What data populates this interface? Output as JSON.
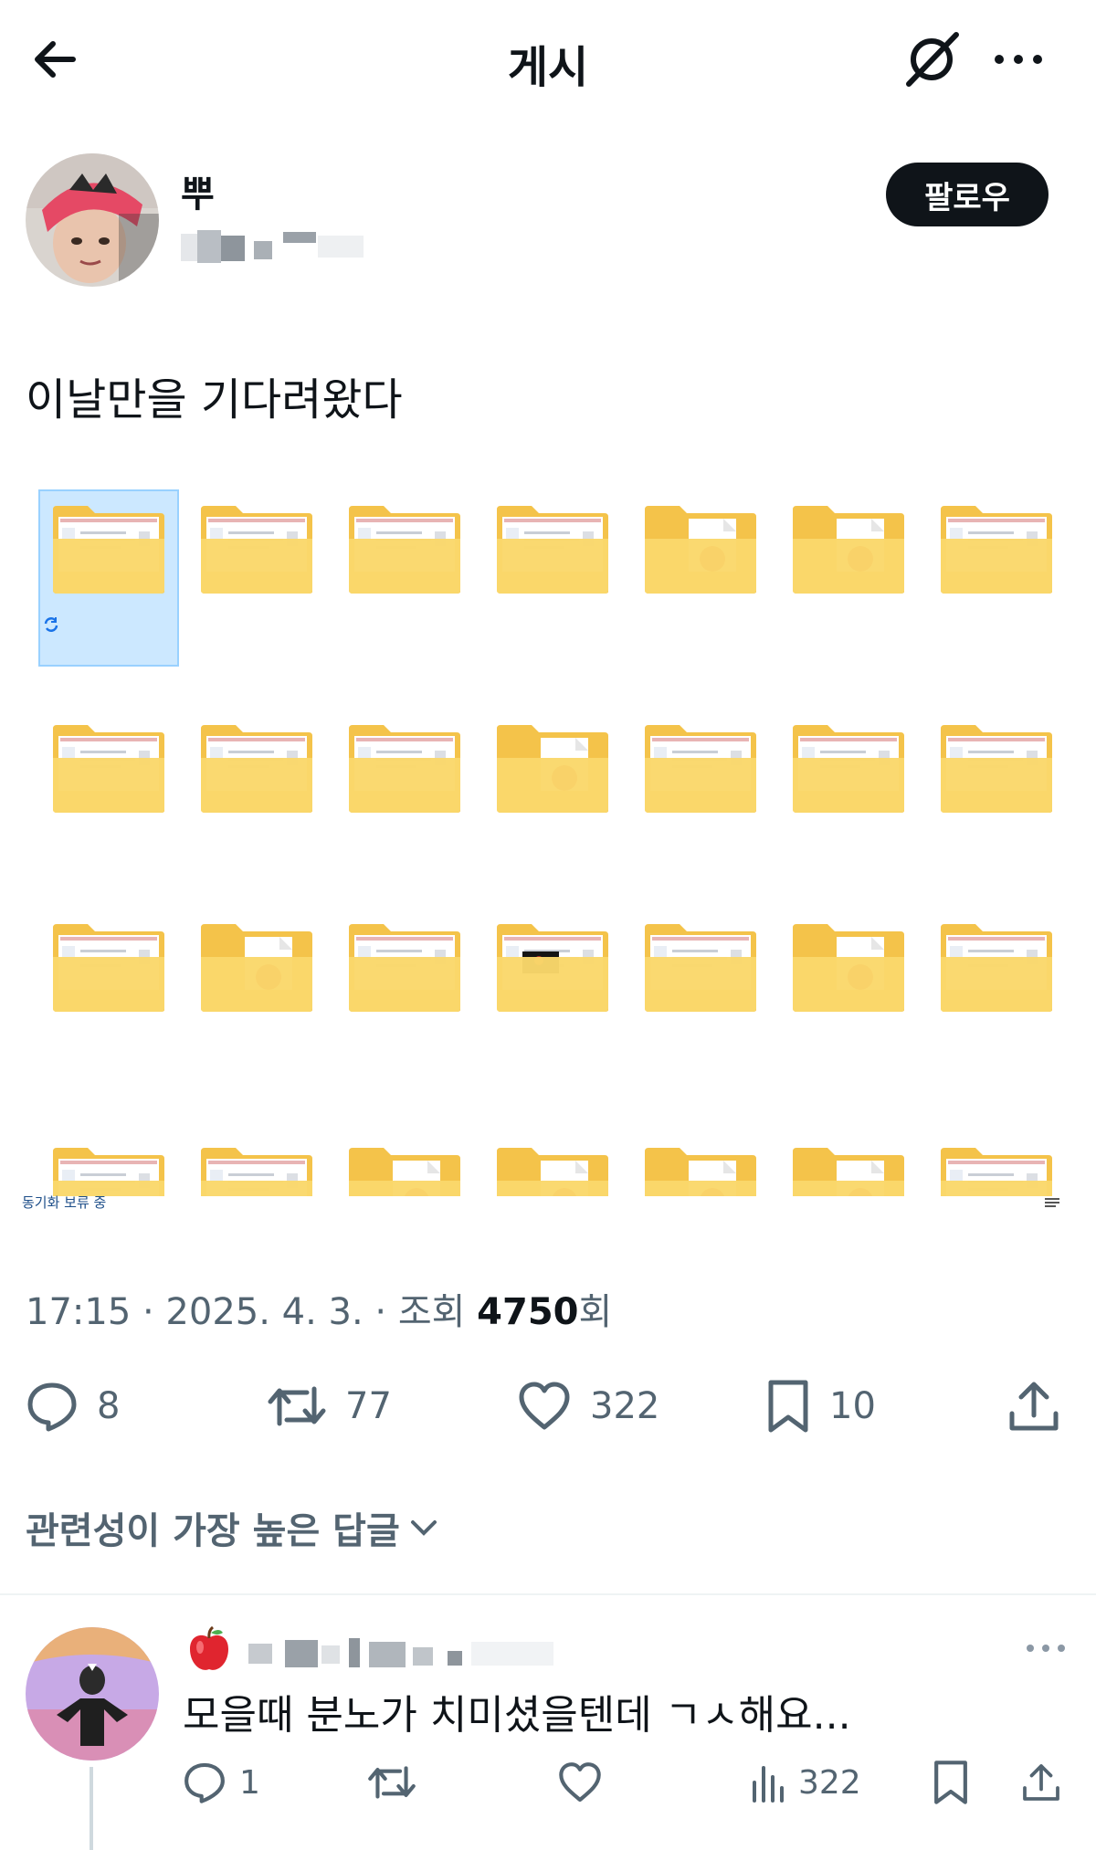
{
  "header": {
    "title": "게시"
  },
  "author": {
    "name": "뿌",
    "follow_label": "팔로우"
  },
  "post": {
    "text": "이날만을 기다려왔다",
    "sync_status": "동기화 보류 중"
  },
  "meta": {
    "time": "17:15 · 2025. 4. 3. · 조회 ",
    "views": "4750",
    "views_suffix": "회"
  },
  "stats": {
    "replies": "8",
    "reposts": "77",
    "likes": "322",
    "bookmarks": "10"
  },
  "replies_section": {
    "sort_label": "관련성이 가장 높은 답글"
  },
  "reply": {
    "text": "모을때 분노가 치미셨을텐데 ㄱㅅ해요...",
    "replies": "1",
    "views": "322"
  },
  "colors": {
    "text_primary": "#0f1419",
    "text_secondary": "#536471",
    "folder_yellow": "#f8d775",
    "selection": "#cce8ff"
  }
}
